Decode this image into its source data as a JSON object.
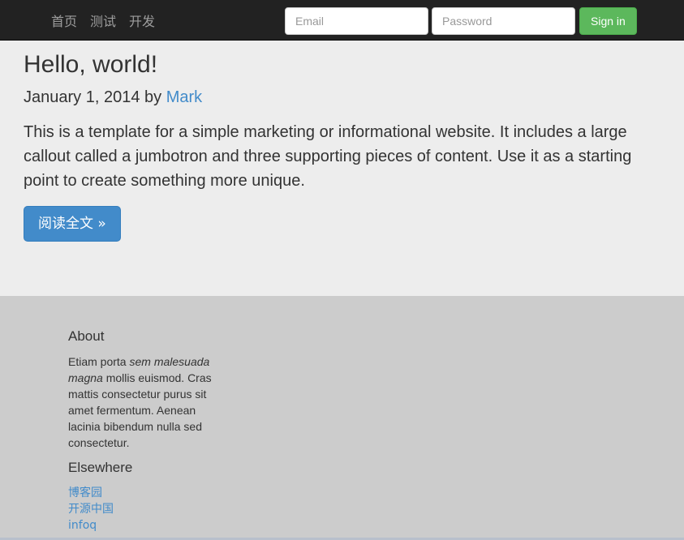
{
  "navbar": {
    "links": [
      "首页",
      "测试",
      "开发"
    ],
    "email_placeholder": "Email",
    "password_placeholder": "Password",
    "signin_label": "Sign in"
  },
  "jumbotron": {
    "title": "Hello, world!",
    "date_prefix": "January 1, 2014 by ",
    "author": "Mark",
    "lead": "This is a template for a simple marketing or informational website. It includes a large callout called a jumbotron and three supporting pieces of content. Use it as a starting point to create something more unique.",
    "button_label": "阅读全文 »"
  },
  "footer": {
    "about_heading": "About",
    "about_text_before": "Etiam porta ",
    "about_text_em": "sem malesuada magna",
    "about_text_after": " mollis euismod. Cras mattis consectetur purus sit amet fermentum. Aenean lacinia bibendum nulla sed consectetur.",
    "elsewhere_heading": "Elsewhere",
    "links": [
      "博客园",
      "开源中国",
      "infoq"
    ]
  },
  "colors": {
    "navbar_bg": "#222222",
    "jumbotron_bg": "#ededed",
    "footer_bg": "#cccccc",
    "primary": "#428bca",
    "success": "#5cb85c"
  }
}
